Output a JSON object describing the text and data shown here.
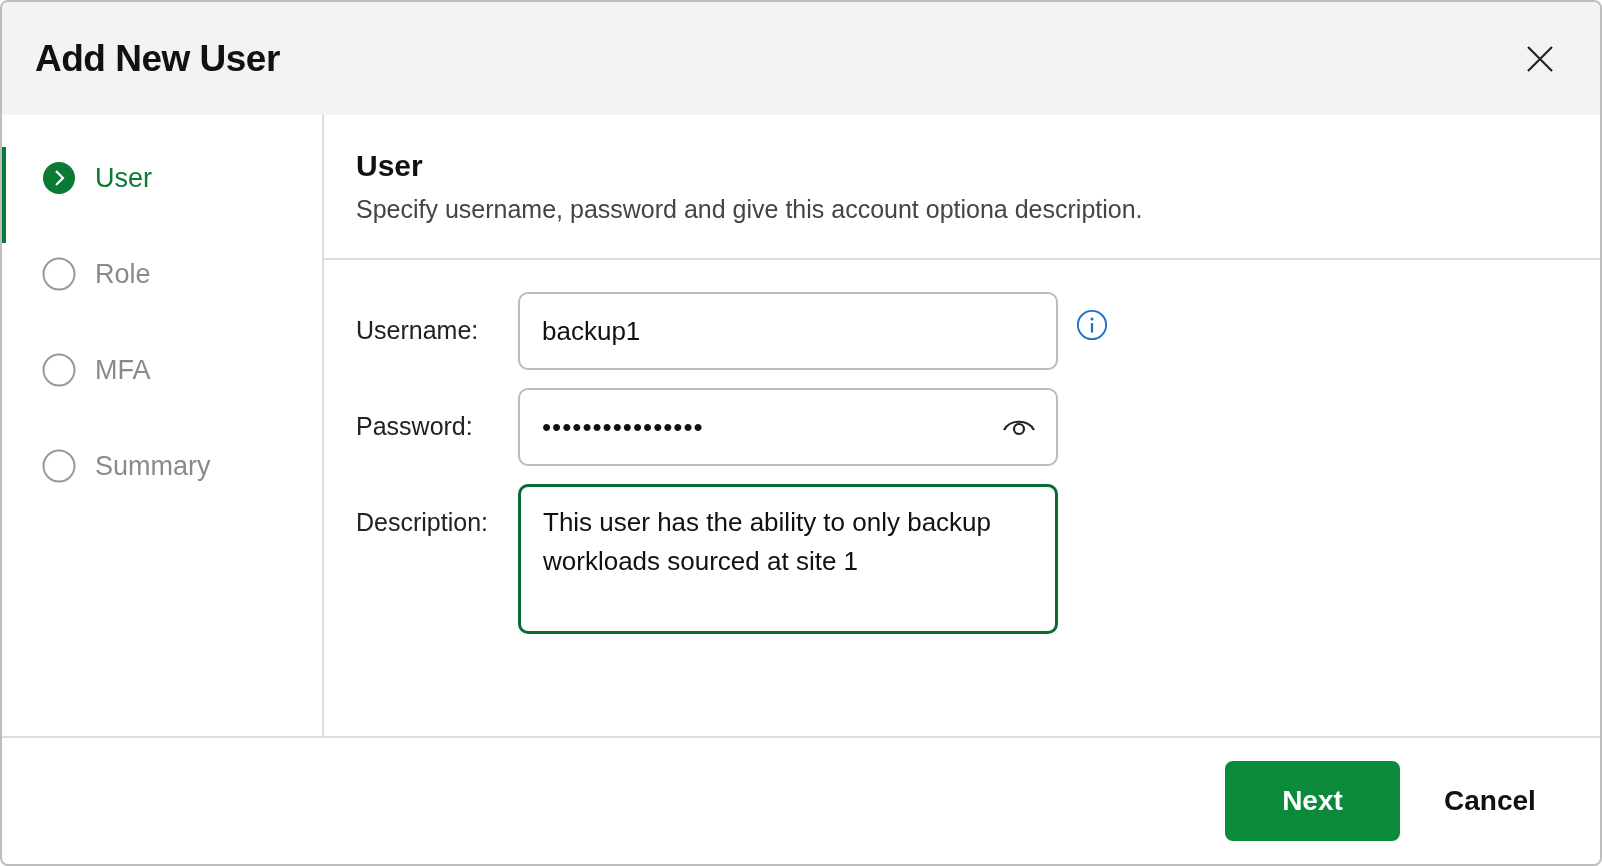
{
  "dialog": {
    "title": "Add New User"
  },
  "steps": [
    {
      "label": "User",
      "selected": true
    },
    {
      "label": "Role",
      "selected": false
    },
    {
      "label": "MFA",
      "selected": false
    },
    {
      "label": "Summary",
      "selected": false
    }
  ],
  "section": {
    "title": "User",
    "description": "Specify username, password and give this account optiona description."
  },
  "fields": [
    {
      "kind": "text",
      "label": "Username:",
      "value": "backup1",
      "focused": false
    },
    {
      "kind": "password",
      "label": "Password:",
      "value": "••••••••••••••••",
      "focused": false
    },
    {
      "kind": "textarea",
      "label": "Description:",
      "value": "This user has the ability to only backup workloads sourced at site 1",
      "focused": true
    }
  ],
  "buttons": [
    {
      "label": "Next",
      "kind": "primary"
    },
    {
      "label": "Cancel",
      "kind": "secondary"
    }
  ]
}
